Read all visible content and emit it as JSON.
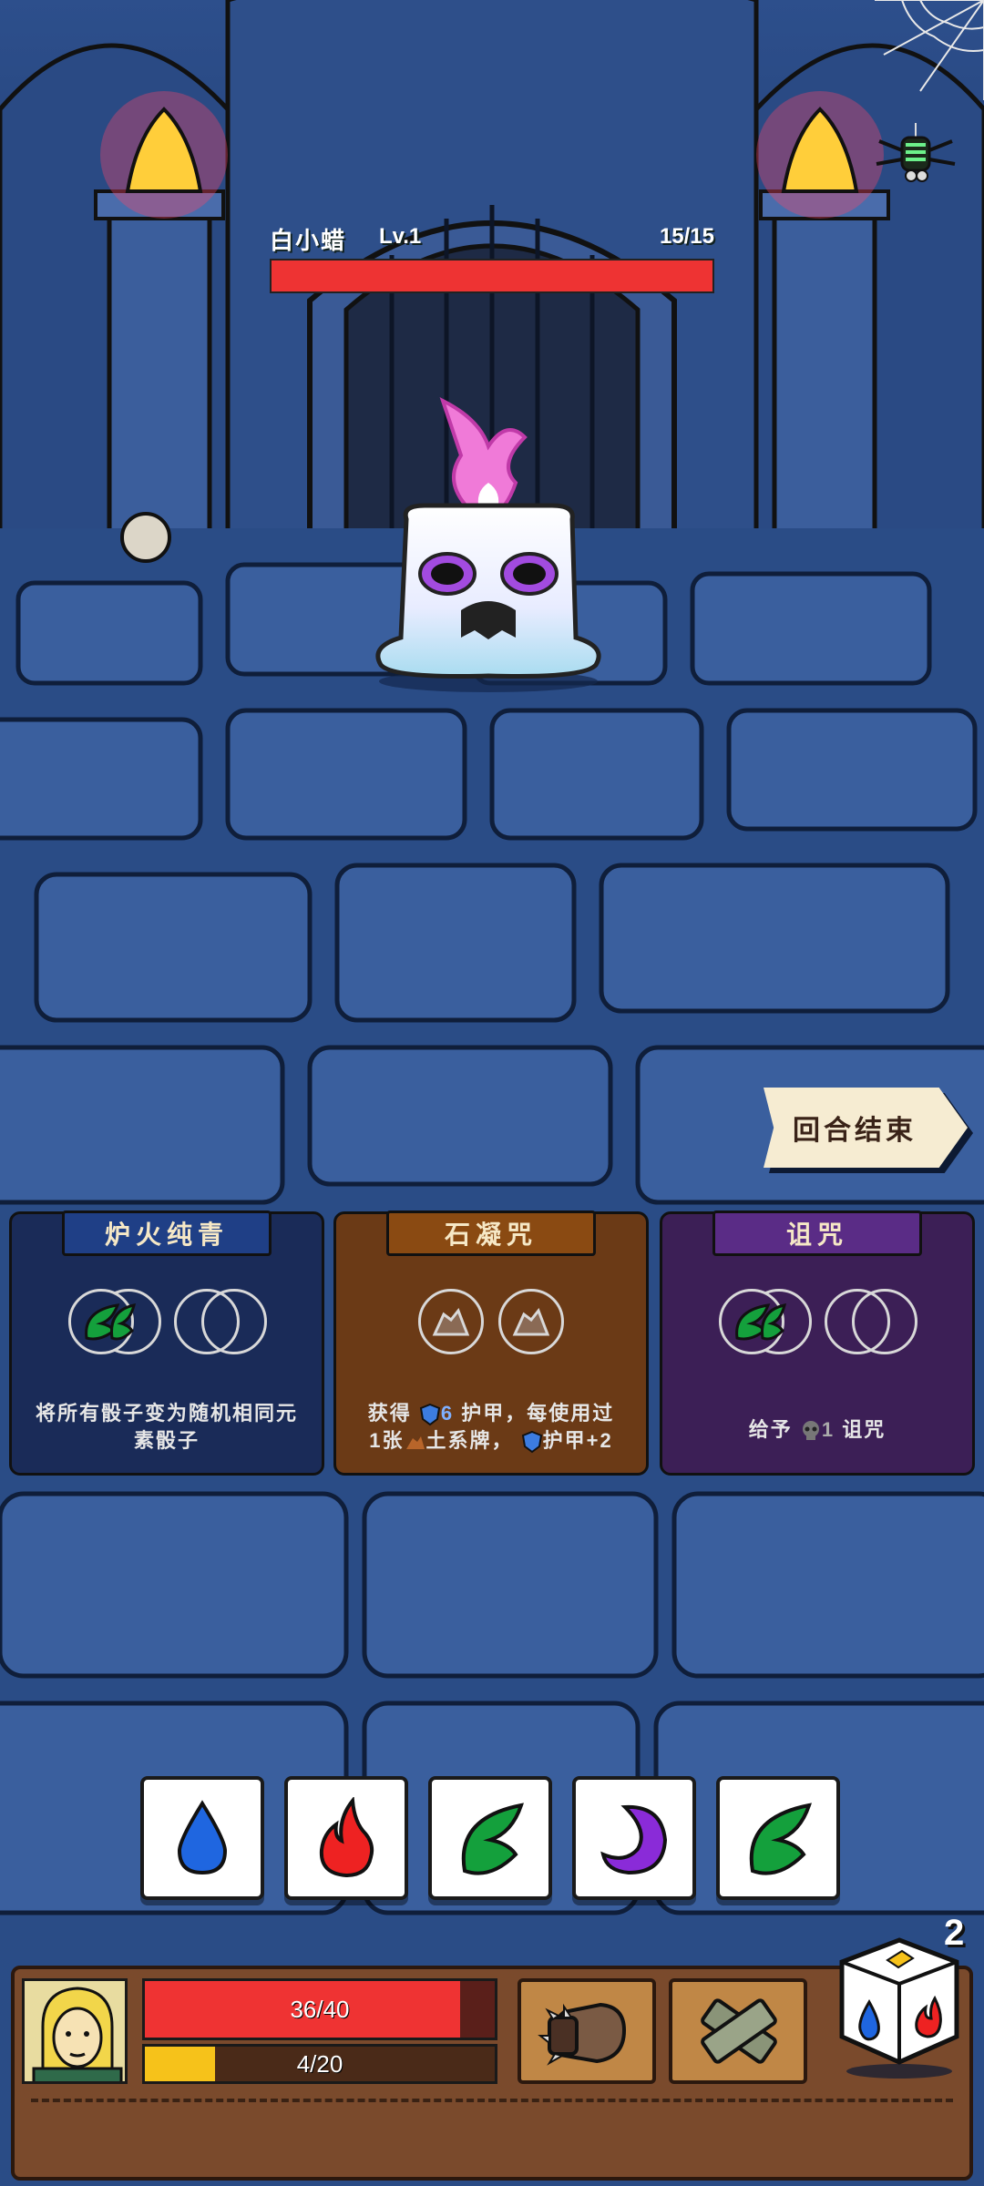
{
  "enemy": {
    "name": "白小蜡",
    "level": "Lv.1",
    "hp_text": "15/15",
    "hp_fraction": 1.0
  },
  "end_turn_label": "回合结束",
  "skill_cards": [
    {
      "title": "炉火纯青",
      "theme": "blue",
      "description": "将所有骰子变为随机相同元素骰子",
      "slots": [
        "nature",
        "empty"
      ]
    },
    {
      "title": "石凝咒",
      "theme": "orange",
      "description_parts": [
        "获得",
        "6",
        "护甲，每使用过",
        "1张",
        "土系牌，",
        "护甲+2"
      ],
      "slots": [
        "earth",
        "earth"
      ]
    },
    {
      "title": "诅咒",
      "theme": "purple",
      "description_parts": [
        "给予",
        "1",
        "诅咒"
      ],
      "slots": [
        "nature",
        "empty"
      ]
    }
  ],
  "dice": [
    "water-drop-icon",
    "fire-icon",
    "leaf-icon",
    "moon-icon",
    "leaf-icon"
  ],
  "player": {
    "hp_text": "36/40",
    "hp_fraction": 0.9,
    "xp_text": "4/20",
    "xp_fraction": 0.2
  },
  "items": [
    "spiked-gauntlet-icon",
    "bandage-icon"
  ],
  "dice_remaining": "2",
  "colors": {
    "hp_red": "#ee3333",
    "xp_yellow": "#f6c21a",
    "water": "#1f66e0",
    "fire": "#ee2222",
    "nature": "#14a03c",
    "shadow": "#8a2bd8"
  }
}
